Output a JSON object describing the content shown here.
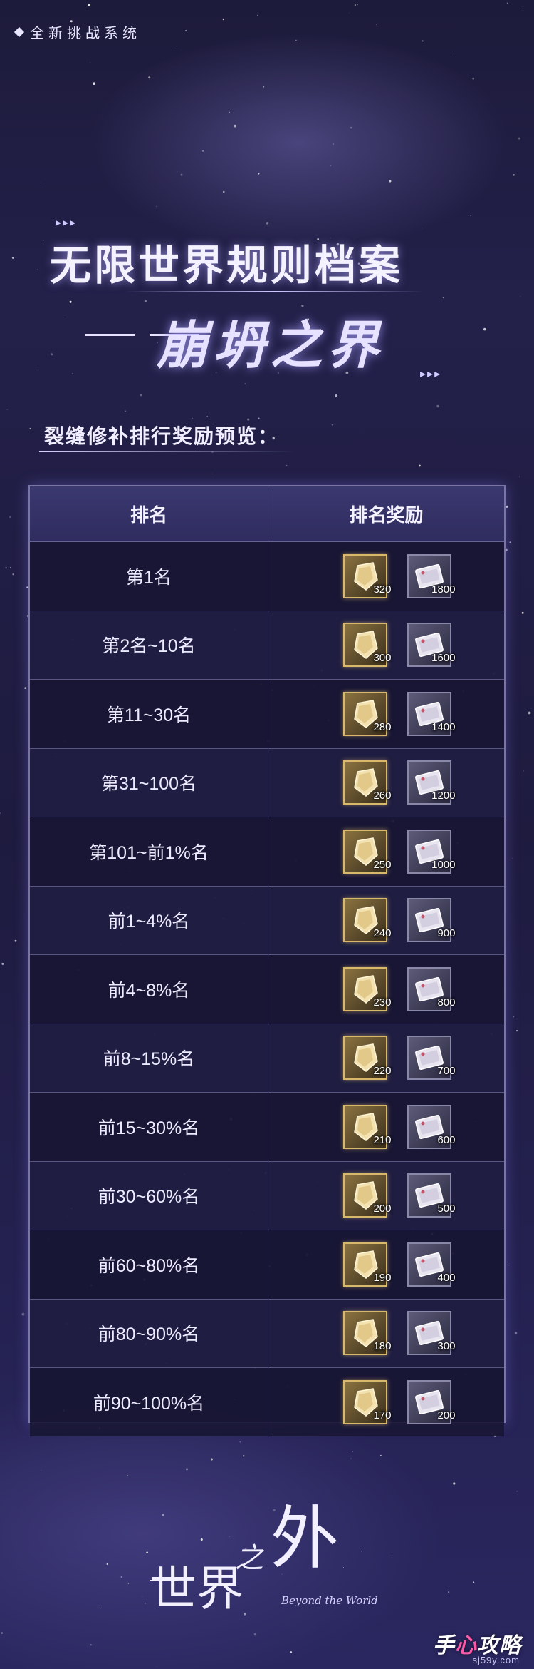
{
  "header": {
    "tag": "全新挑战系统"
  },
  "title": {
    "main": "无限世界规则档案",
    "sub": "崩坍之界"
  },
  "section": {
    "heading": "裂缝修补排行奖励预览："
  },
  "table": {
    "columns": [
      "排名",
      "排名奖励"
    ],
    "rows": [
      {
        "rank": "第1名",
        "gold": "320",
        "silver": "1800"
      },
      {
        "rank": "第2名~10名",
        "gold": "300",
        "silver": "1600"
      },
      {
        "rank": "第11~30名",
        "gold": "280",
        "silver": "1400"
      },
      {
        "rank": "第31~100名",
        "gold": "260",
        "silver": "1200"
      },
      {
        "rank": "第101~前1%名",
        "gold": "250",
        "silver": "1000"
      },
      {
        "rank": "前1~4%名",
        "gold": "240",
        "silver": "900"
      },
      {
        "rank": "前4~8%名",
        "gold": "230",
        "silver": "800"
      },
      {
        "rank": "前8~15%名",
        "gold": "220",
        "silver": "700"
      },
      {
        "rank": "前15~30%名",
        "gold": "210",
        "silver": "600"
      },
      {
        "rank": "前30~60%名",
        "gold": "200",
        "silver": "500"
      },
      {
        "rank": "前60~80%名",
        "gold": "190",
        "silver": "400"
      },
      {
        "rank": "前80~90%名",
        "gold": "180",
        "silver": "300"
      },
      {
        "rank": "前90~100%名",
        "gold": "170",
        "silver": "200"
      }
    ]
  },
  "icons": {
    "gold_item": "gold-crystal-icon",
    "silver_item": "silver-ticket-icon"
  },
  "colors": {
    "gold_frame": "#d8b86a",
    "silver_frame": "#8a88a8",
    "background": "#1e1b3f"
  },
  "footer": {
    "logo": "世界之外",
    "logo_subtitle": "Beyond the World",
    "watermark_a": "手",
    "watermark_b": "心",
    "watermark_c": "攻略",
    "watermark_url": "sj59y.com"
  }
}
